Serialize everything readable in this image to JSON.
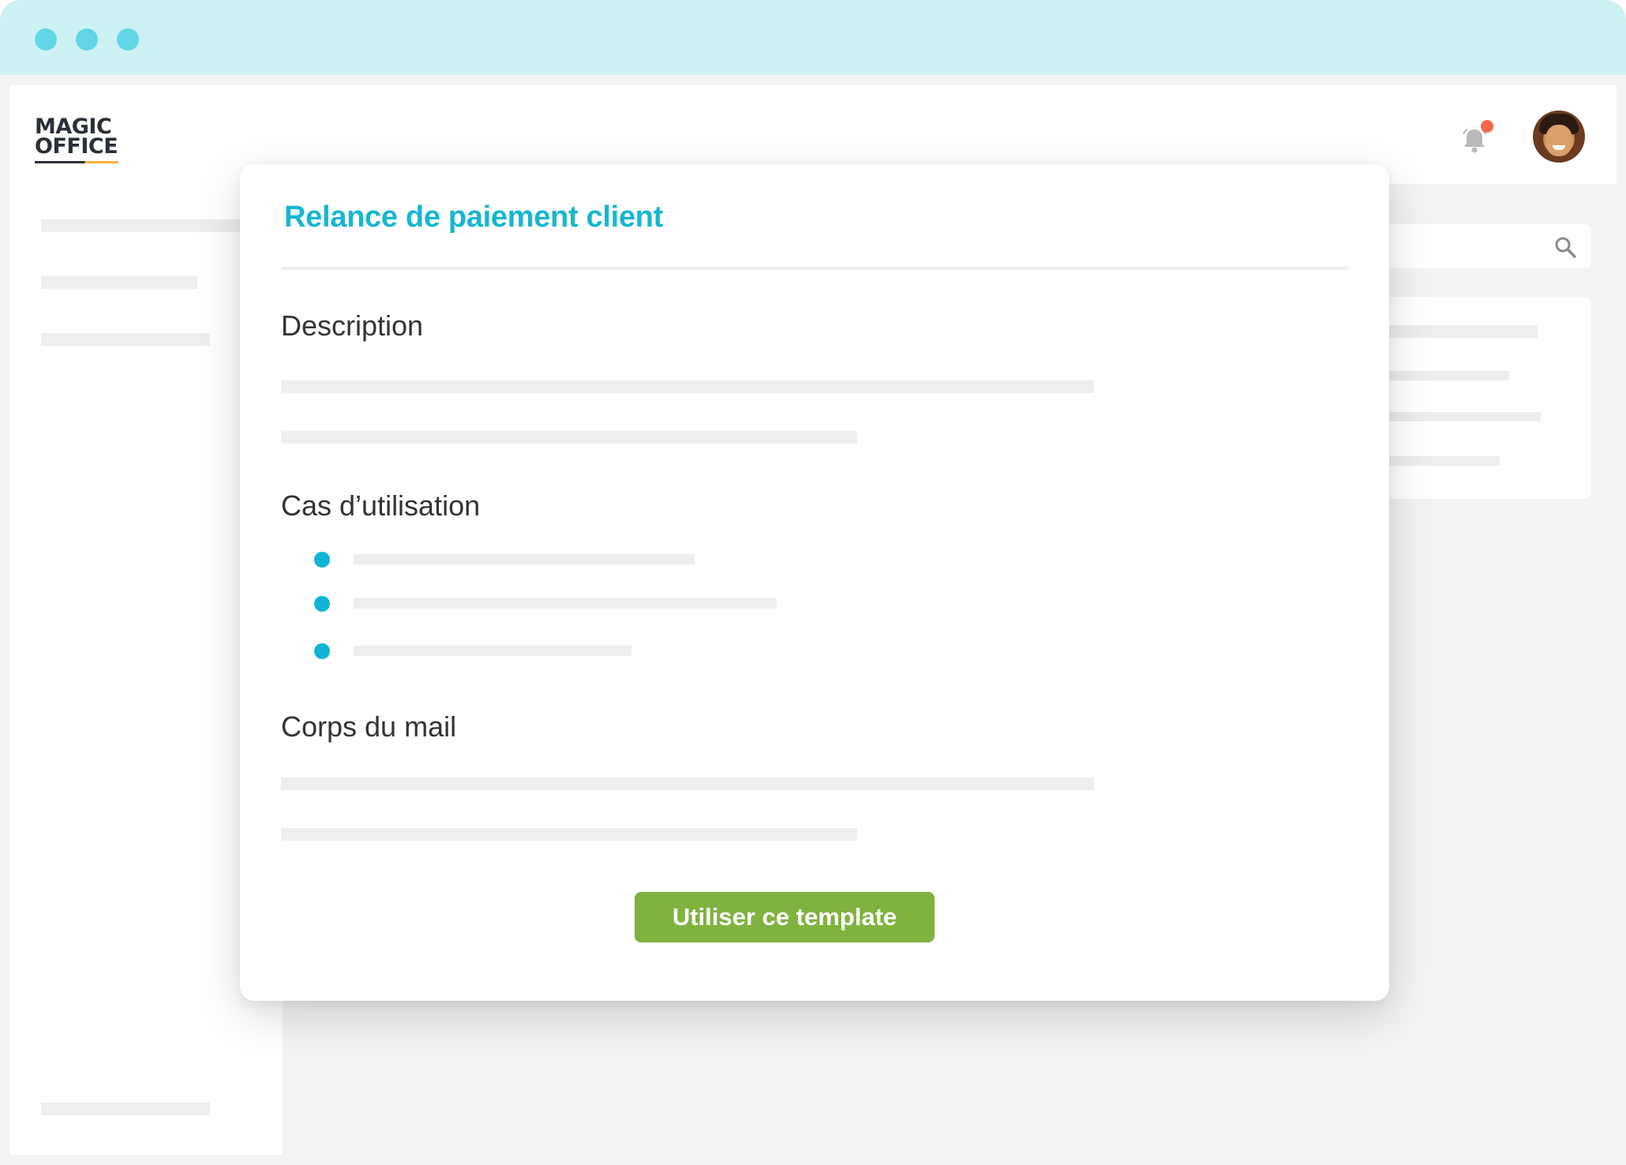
{
  "window": {
    "traffic_lights": [
      "dot",
      "dot",
      "dot"
    ]
  },
  "app": {
    "logo": {
      "line1": "MAGIC",
      "line2": "OFFICE"
    },
    "notifications": {
      "icon": "bell-icon",
      "badge_color": "#f56a4a"
    },
    "user": {
      "icon": "avatar"
    },
    "search": {
      "icon": "search-icon"
    }
  },
  "modal": {
    "title": "Relance de paiement client",
    "sections": {
      "description": "Description",
      "use_cases": "Cas d’utilisation",
      "mail_body": "Corps du mail"
    },
    "cta_label": "Utiliser ce template"
  },
  "colors": {
    "accent": "#17b6d1",
    "bullet": "#12b4d6",
    "button": "#7fb23f",
    "titlebar": "#cdf1f5",
    "traffic_light": "#62d6e6"
  }
}
